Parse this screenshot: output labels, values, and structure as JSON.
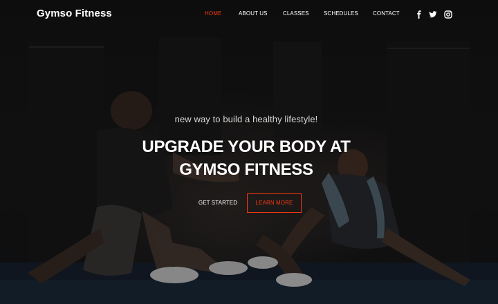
{
  "header": {
    "brand": "Gymso Fitness",
    "nav": [
      {
        "label": "HOME",
        "active": true
      },
      {
        "label": "ABOUT US",
        "active": false
      },
      {
        "label": "CLASSES",
        "active": false
      },
      {
        "label": "SCHEDULES",
        "active": false
      },
      {
        "label": "CONTACT",
        "active": false
      }
    ],
    "social": [
      "facebook-icon",
      "twitter-icon",
      "instagram-icon"
    ]
  },
  "hero": {
    "subtitle": "new way to build a healthy lifestyle!",
    "title_line1": "UPGRADE YOUR BODY AT",
    "title_line2": "GYMSO FITNESS",
    "primary_button": "GET STARTED",
    "secondary_button": "LEARN MORE",
    "background_image": "two athletes sitting on gym floor"
  },
  "colors": {
    "accent": "#f13a11",
    "text": "#ffffff",
    "background": "#151516"
  }
}
